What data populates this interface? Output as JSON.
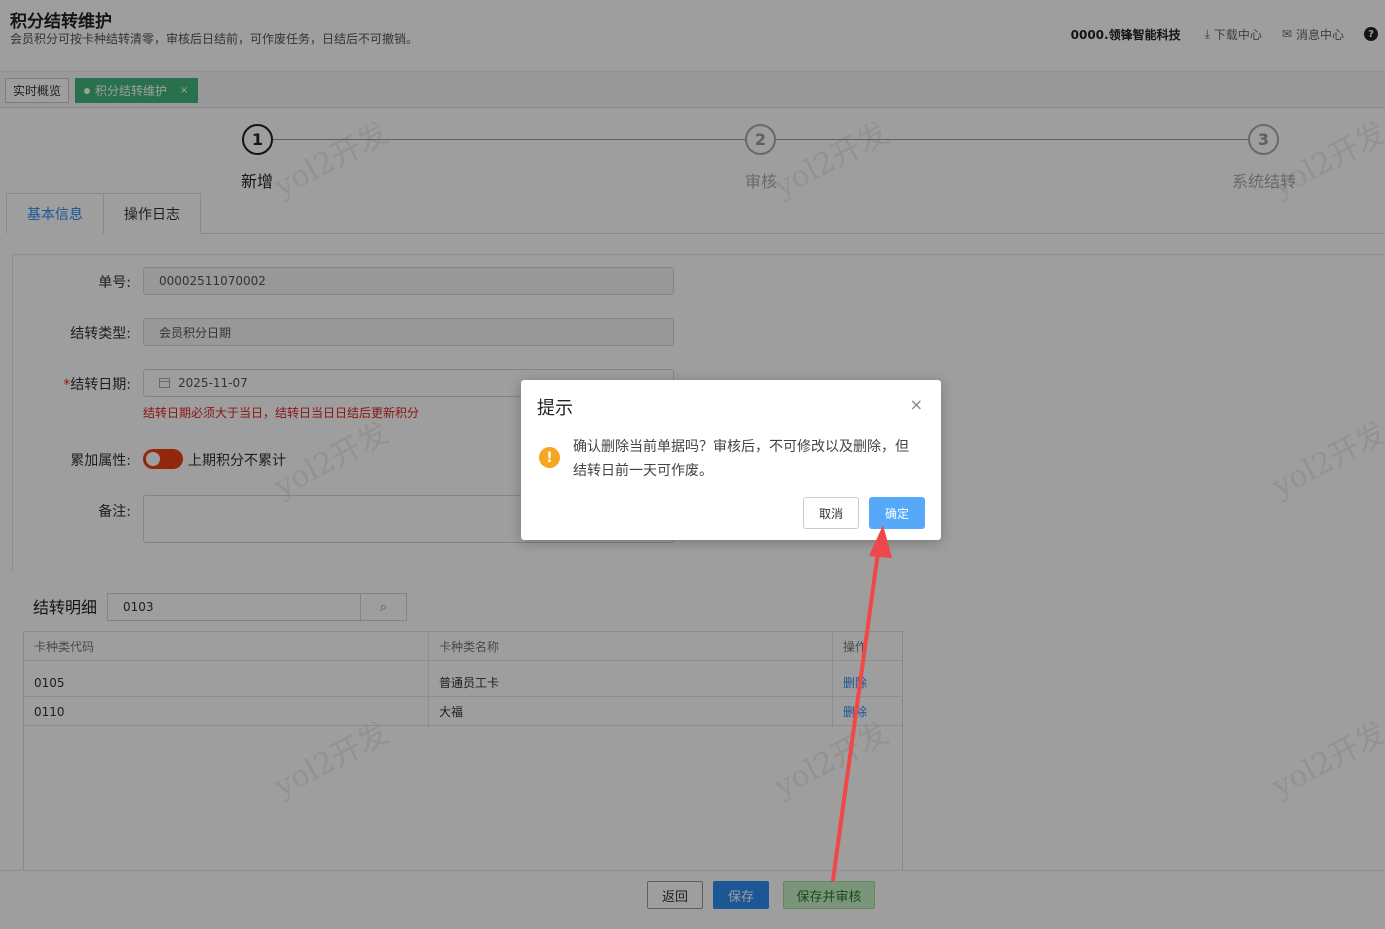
{
  "header": {
    "title": "积分结转维护",
    "subtitle": "会员积分可按卡种结转清零，审核后日结前，可作废任务，日结后不可撤销。",
    "company": "0000.领锋智能科技",
    "download_center": "下载中心",
    "message_center": "消息中心",
    "help_icon": "?"
  },
  "tabs": {
    "overview": "实时概览",
    "active": "积分结转维护",
    "close": "×"
  },
  "steps": [
    {
      "num": "1",
      "label": "新增"
    },
    {
      "num": "2",
      "label": "审核"
    },
    {
      "num": "3",
      "label": "系统结转"
    }
  ],
  "content_tabs": {
    "basic": "基本信息",
    "log": "操作日志"
  },
  "form": {
    "order_no_label": "单号:",
    "order_no_value": "00002511070002",
    "type_label": "结转类型:",
    "type_value": "会员积分日期",
    "date_required": "*",
    "date_label": "结转日期:",
    "date_value": "2025-11-07",
    "date_error": "结转日期必须大于当日，结转日当日日结后更新积分",
    "accumulate_label": "累加属性:",
    "accumulate_value": "上期积分不累计",
    "remark_label": "备注:"
  },
  "details": {
    "title": "结转明细",
    "search_value": "0103",
    "columns": [
      "卡种类代码",
      "卡种类名称",
      "操作"
    ],
    "rows": [
      {
        "code": "0105",
        "name": "普通员工卡",
        "action": "删除"
      },
      {
        "code": "0110",
        "name": "大福",
        "action": "删除"
      }
    ]
  },
  "footer": {
    "back": "返回",
    "save": "保存",
    "save_audit": "保存并审核"
  },
  "watermark": "yol2开发",
  "dialog": {
    "title": "提示",
    "close": "×",
    "warn_icon": "!",
    "message": "确认删除当前单据吗？审核后，不可修改以及删除，但结转日前一天可作废。",
    "cancel": "取消",
    "ok": "确定"
  },
  "colors": {
    "primary": "#2d8cf0",
    "tab_active": "#43b77d",
    "danger": "#e02424",
    "warning": "#f5a623",
    "dialog_ok": "#56a9f9",
    "annotation_arrow": "#f04848"
  }
}
